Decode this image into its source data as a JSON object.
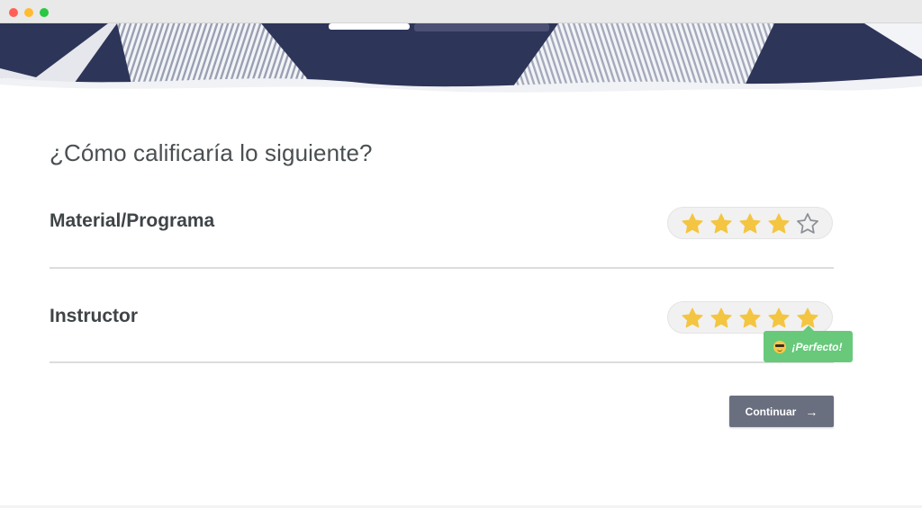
{
  "window": {
    "controls": [
      "close",
      "minimize",
      "maximize"
    ]
  },
  "survey": {
    "question": "¿Cómo calificaría lo siguiente?",
    "items": [
      {
        "label": "Material/Programa",
        "rating": 4,
        "max": 5
      },
      {
        "label": "Instructor",
        "rating": 5,
        "max": 5
      }
    ],
    "feedback": {
      "text": "¡Perfecto!",
      "icon": "sunglasses-emoji-icon"
    },
    "continue_label": "Continuar",
    "continue_icon": "arrow-right-icon"
  },
  "colors": {
    "star_filled": "#f4c541",
    "star_empty": "#8a9096",
    "tooltip": "#68c97b",
    "button": "#6a6f80",
    "banner_navy": "#2d3559"
  }
}
